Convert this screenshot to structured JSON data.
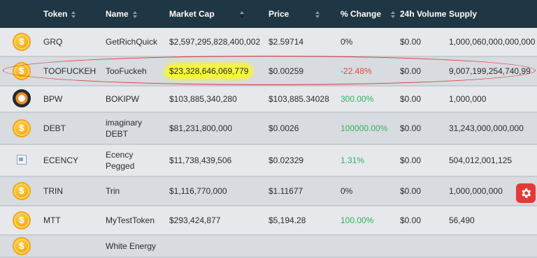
{
  "columns": [
    {
      "label": "",
      "sortable": false
    },
    {
      "label": "Token",
      "sortable": true
    },
    {
      "label": "Name",
      "sortable": true
    },
    {
      "label": "Market Cap",
      "sortable": true,
      "active": true
    },
    {
      "label": "Price",
      "sortable": true
    },
    {
      "label": "% Change",
      "sortable": true
    },
    {
      "label": "24h Volume",
      "sortable": false
    },
    {
      "label": "Supply",
      "sortable": false
    }
  ],
  "rows": [
    {
      "icon": "dollar-coin-icon",
      "token": "GRQ",
      "name": "GetRichQuick",
      "market_cap": "$2,597,295,828,400,002",
      "price": "$2.59714",
      "change": "0%",
      "change_color": "neutral",
      "volume": "$0.00",
      "supply": "1,000,060,000,000,000"
    },
    {
      "icon": "dollar-coin-icon",
      "token": "TOOFUCKEH",
      "name": "TooFuckeh",
      "market_cap": "$23,328,646,069,779",
      "price": "$0.00259",
      "change": "-22.48%",
      "change_color": "negative",
      "volume": "$0.00",
      "supply": "9,007,199,254,740,99",
      "highlighted": true
    },
    {
      "icon": "bpw-logo-icon",
      "token": "BPW",
      "name": "BOKIPW",
      "market_cap": "$103,885,340,280",
      "price": "$103,885.34028",
      "change": "300.00%",
      "change_color": "positive",
      "volume": "$0.00",
      "supply": "1,000,000"
    },
    {
      "icon": "dollar-coin-icon",
      "token": "DEBT",
      "name": "imaginary DEBT",
      "market_cap": "$81,231,800,000",
      "price": "$0.0026",
      "change": "100000.00%",
      "change_color": "positive",
      "volume": "$0.00",
      "supply": "31,243,000,000,000"
    },
    {
      "icon": "broken-image-icon",
      "token": "ECENCY",
      "name": "Ecency Pegged",
      "market_cap": "$11,738,439,506",
      "price": "$0.02329",
      "change": "1.31%",
      "change_color": "positive",
      "volume": "$0.00",
      "supply": "504,012,001,125"
    },
    {
      "icon": "dollar-coin-icon",
      "token": "TRIN",
      "name": "Trin",
      "market_cap": "$1,116,770,000",
      "price": "$1.11677",
      "change": "0%",
      "change_color": "neutral",
      "volume": "$0.00",
      "supply": "1,000,000,000"
    },
    {
      "icon": "dollar-coin-icon",
      "token": "MTT",
      "name": "MyTestToken",
      "market_cap": "$293,424,877",
      "price": "$5,194.28",
      "change": "100.00%",
      "change_color": "positive",
      "volume": "$0.00",
      "supply": "56,490"
    },
    {
      "icon": "dollar-coin-icon",
      "token": "",
      "name": "White Energy",
      "market_cap": "",
      "price": "",
      "change": "",
      "change_color": "neutral",
      "volume": "",
      "supply": ""
    }
  ],
  "coin_glyph": "$",
  "colors": {
    "header_bg": "#1f3644",
    "row_bg": "#e6e8ec",
    "positive": "#2fb35b",
    "negative": "#e0483a",
    "highlight": "#f5f53a",
    "annotation": "#d23b3b",
    "settings_button": "#e53935"
  },
  "settings_button_icon": "gear-icon"
}
